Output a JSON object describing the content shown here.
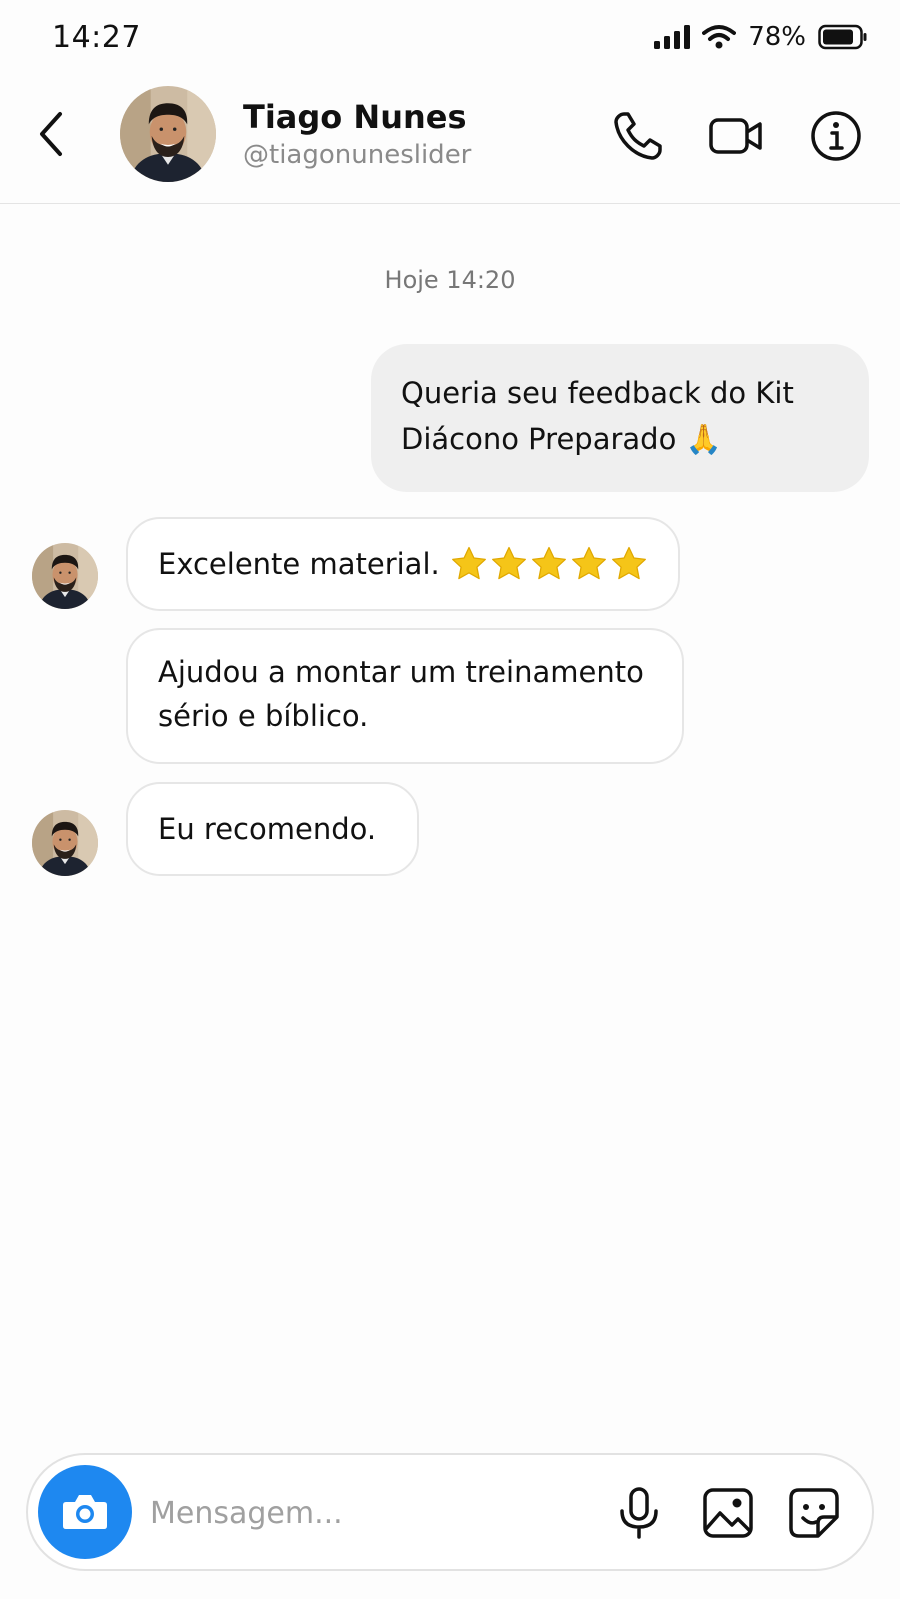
{
  "status_bar": {
    "time": "14:27",
    "battery": "78%",
    "icons": [
      "signal-icon",
      "wifi-icon",
      "battery-icon"
    ]
  },
  "header": {
    "name": "Tiago Nunes",
    "handle": "@tiagonuneslider",
    "icons": [
      "back-arrow-icon",
      "phone-icon",
      "video-camera-icon",
      "info-icon"
    ]
  },
  "chat": {
    "date_label": "Hoje 14:20",
    "messages": [
      {
        "direction": "outgoing",
        "text": "Queria seu feedback do Kit Diácono Preparado 🙏"
      },
      {
        "direction": "incoming",
        "text": "Excelente material.",
        "rating_stars": 5
      },
      {
        "direction": "incoming",
        "text": "Ajudou a montar um treinamento sério e bíblico."
      },
      {
        "direction": "incoming",
        "text": "Eu recomendo."
      }
    ]
  },
  "composer": {
    "placeholder": "Mensagem...",
    "icons": [
      "camera-icon",
      "microphone-icon",
      "image-icon",
      "sticker-icon"
    ]
  },
  "colors": {
    "accent": "#1e88f0",
    "outgoing_bubble": "#efefef",
    "star": "#f5c518"
  }
}
